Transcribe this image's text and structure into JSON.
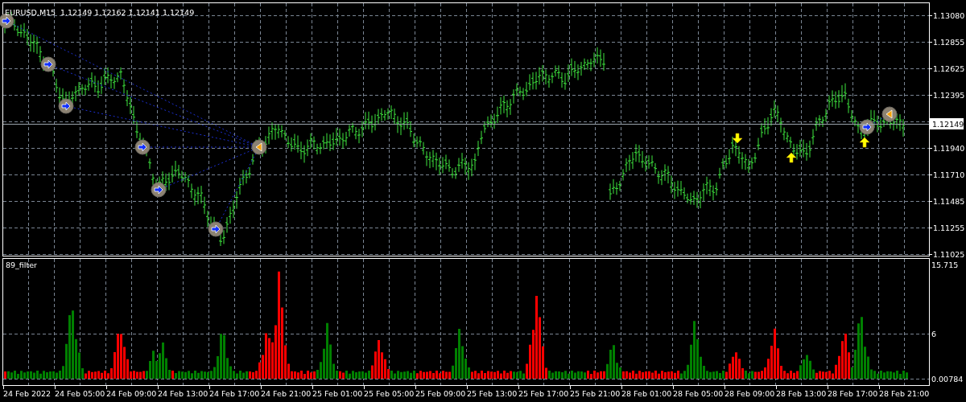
{
  "chart": {
    "symbol": "EURUSD,M15",
    "quote": "1.12149 1.12162 1.12141 1.12149",
    "price_axis": [
      "1.13080",
      "1.12855",
      "1.12625",
      "1.12395",
      "1.11940",
      "1.11710",
      "1.11485",
      "1.11255",
      "1.11025"
    ],
    "current_price": "1.12149"
  },
  "indicator": {
    "name": "89_filter",
    "axis": [
      "15.715",
      "6",
      "0.00784"
    ]
  },
  "time_axis": [
    "24 Feb 2022",
    "24 Feb 05:00",
    "24 Feb 09:00",
    "24 Feb 13:00",
    "24 Feb 17:00",
    "24 Feb 21:00",
    "25 Feb 01:00",
    "25 Feb 05:00",
    "25 Feb 09:00",
    "25 Feb 13:00",
    "25 Feb 17:00",
    "25 Feb 21:00",
    "28 Feb 01:00",
    "28 Feb 05:00",
    "28 Feb 09:00",
    "28 Feb 13:00",
    "28 Feb 17:00",
    "28 Feb 21:00"
  ]
}
